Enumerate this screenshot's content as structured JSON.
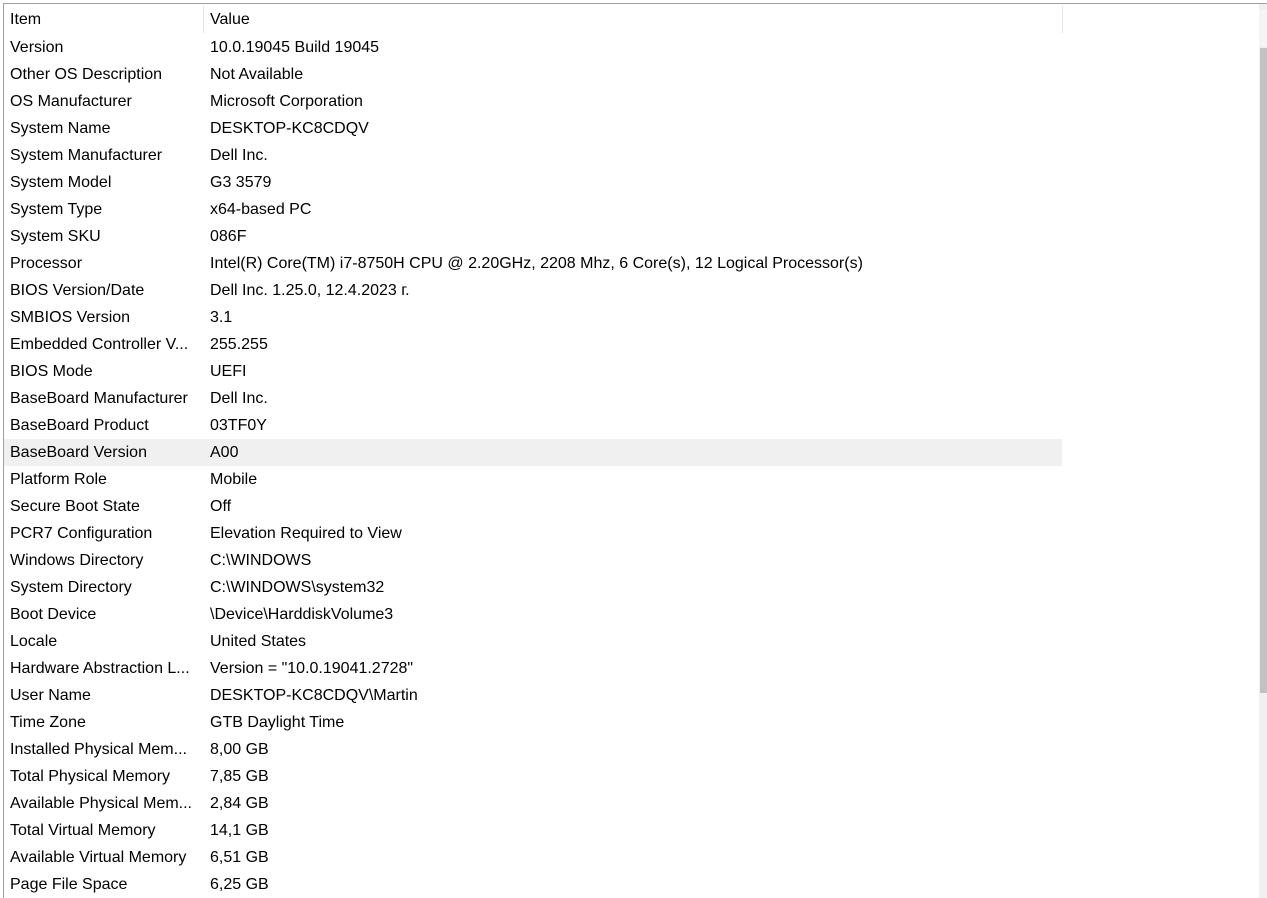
{
  "columns": {
    "item": "Item",
    "value": "Value"
  },
  "selected_index": 15,
  "rows": [
    {
      "item": "Version",
      "value": "10.0.19045 Build 19045"
    },
    {
      "item": "Other OS Description",
      "value": "Not Available"
    },
    {
      "item": "OS Manufacturer",
      "value": "Microsoft Corporation"
    },
    {
      "item": "System Name",
      "value": "DESKTOP-KC8CDQV"
    },
    {
      "item": "System Manufacturer",
      "value": "Dell Inc."
    },
    {
      "item": "System Model",
      "value": "G3 3579"
    },
    {
      "item": "System Type",
      "value": "x64-based PC"
    },
    {
      "item": "System SKU",
      "value": "086F"
    },
    {
      "item": "Processor",
      "value": "Intel(R) Core(TM) i7-8750H CPU @ 2.20GHz, 2208 Mhz, 6 Core(s), 12 Logical Processor(s)"
    },
    {
      "item": "BIOS Version/Date",
      "value": "Dell Inc. 1.25.0, 12.4.2023 г."
    },
    {
      "item": "SMBIOS Version",
      "value": "3.1"
    },
    {
      "item": "Embedded Controller V...",
      "value": "255.255"
    },
    {
      "item": "BIOS Mode",
      "value": "UEFI"
    },
    {
      "item": "BaseBoard Manufacturer",
      "value": "Dell Inc."
    },
    {
      "item": "BaseBoard Product",
      "value": "03TF0Y"
    },
    {
      "item": "BaseBoard Version",
      "value": "A00"
    },
    {
      "item": "Platform Role",
      "value": "Mobile"
    },
    {
      "item": "Secure Boot State",
      "value": "Off"
    },
    {
      "item": "PCR7 Configuration",
      "value": "Elevation Required to View"
    },
    {
      "item": "Windows Directory",
      "value": "C:\\WINDOWS"
    },
    {
      "item": "System Directory",
      "value": "C:\\WINDOWS\\system32"
    },
    {
      "item": "Boot Device",
      "value": "\\Device\\HarddiskVolume3"
    },
    {
      "item": "Locale",
      "value": "United States"
    },
    {
      "item": "Hardware Abstraction L...",
      "value": "Version = \"10.0.19041.2728\""
    },
    {
      "item": "User Name",
      "value": "DESKTOP-KC8CDQV\\Martin"
    },
    {
      "item": "Time Zone",
      "value": "GTB Daylight Time"
    },
    {
      "item": "Installed Physical Mem...",
      "value": "8,00 GB"
    },
    {
      "item": "Total Physical Memory",
      "value": "7,85 GB"
    },
    {
      "item": "Available Physical Mem...",
      "value": "2,84 GB"
    },
    {
      "item": "Total Virtual Memory",
      "value": "14,1 GB"
    },
    {
      "item": "Available Virtual Memory",
      "value": "6,51 GB"
    },
    {
      "item": "Page File Space",
      "value": "6,25 GB"
    }
  ],
  "scrollbar": {
    "up_icon": "chevron-up-icon"
  }
}
